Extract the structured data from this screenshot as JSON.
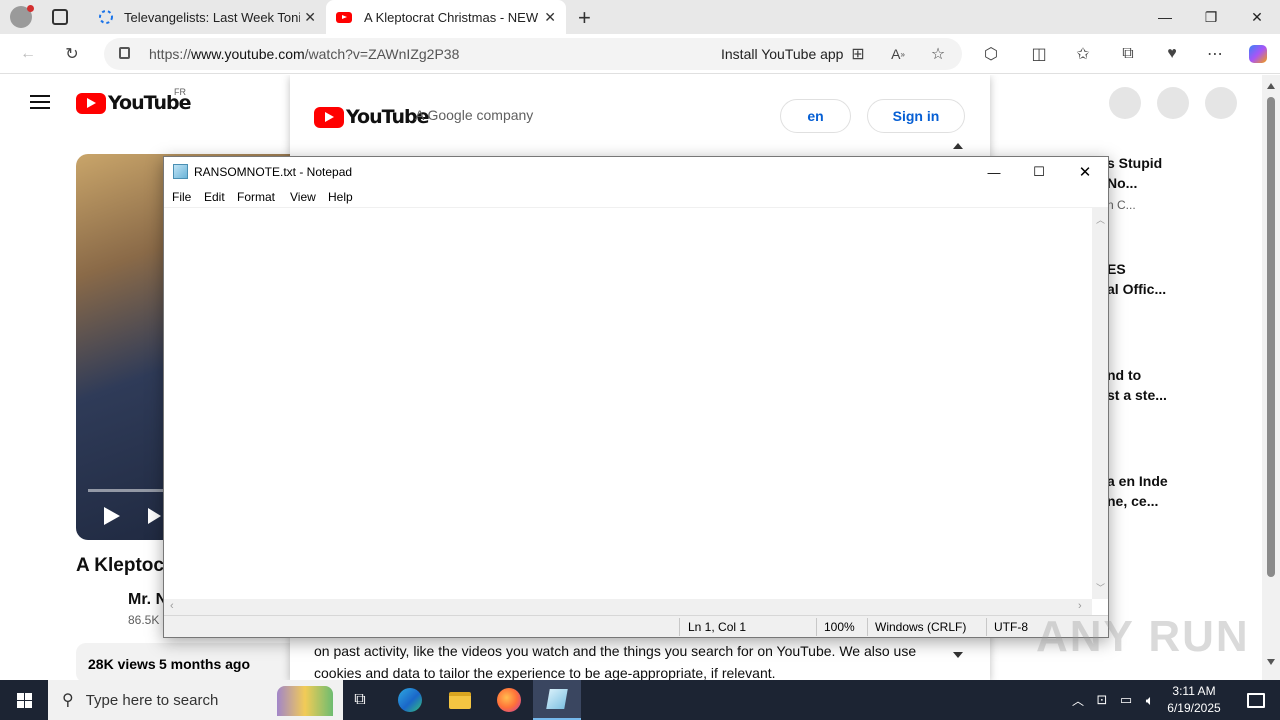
{
  "browser": {
    "tabs": [
      {
        "title": "Televangelists: Last Week Tonight",
        "active": false
      },
      {
        "title": "A Kleptocrat Christmas - NEW CH",
        "active": true
      }
    ],
    "url_prefix": "https://",
    "url_host": "www.youtube.com",
    "url_path": "/watch?v=ZAWnIZg2P38",
    "install_label": "Install YouTube app"
  },
  "youtube": {
    "logo_text": "YouTube",
    "region": "FR",
    "consent": {
      "logo_text": "YouTube",
      "company": "A Google company",
      "lang_button": "en",
      "signin_button": "Sign in",
      "body_line1": "on past activity, like the videos you watch and the things you search for on YouTube. We also use",
      "body_line2": "cookies and data to tailor the experience to be age-appropriate, if relevant."
    },
    "video_title_partial": "A Kleptoc",
    "channel_partial": "Mr. N",
    "subscribers_partial": "86.5K",
    "views": "28K views",
    "age": "5 months ago",
    "sidebar": [
      {
        "line1": "s Stupid",
        "line2": "No...",
        "meta": "n C..."
      },
      {
        "line1": "ES",
        "line2": "al Offic...",
        "meta": ""
      },
      {
        "line1": "nd to",
        "line2": "st a ste...",
        "meta": ""
      },
      {
        "line1": "a en Inde",
        "line2": "ne, ce...",
        "meta": ""
      }
    ]
  },
  "notepad": {
    "title": "RANSOMNOTE.txt - Notepad",
    "menu": [
      "File",
      "Edit",
      "Format",
      "View",
      "Help"
    ],
    "status": {
      "position": "Ln 1, Col 1",
      "zoom": "100%",
      "line_ending": "Windows (CRLF)",
      "encoding": "UTF-8"
    }
  },
  "taskbar": {
    "search_placeholder": "Type here to search",
    "time": "3:11 AM",
    "date": "6/19/2025"
  },
  "watermark": "ANY RUN",
  "colors": {
    "yt_red": "#ff0000",
    "link_blue": "#065fd4",
    "taskbar": "#1c2433"
  }
}
